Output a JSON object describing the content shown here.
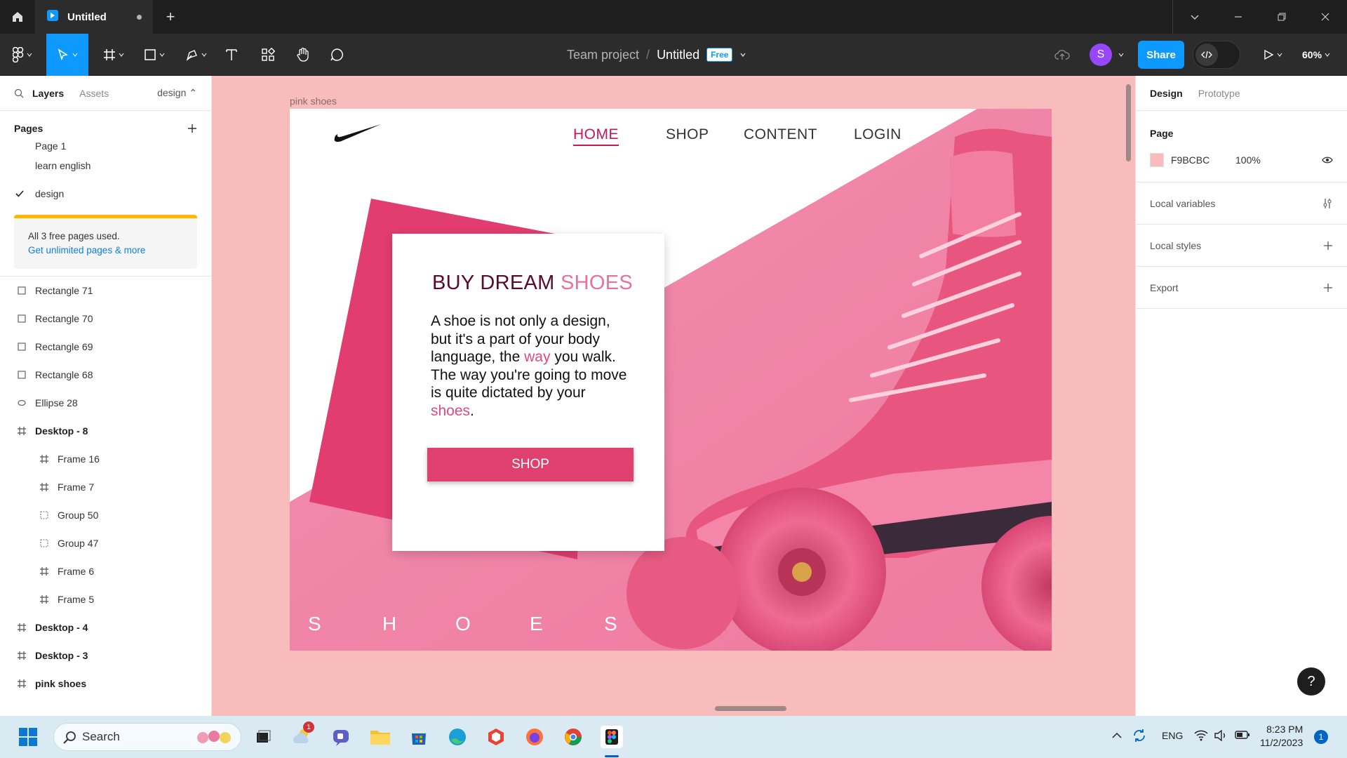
{
  "titlebar": {
    "tab_title": "Untitled",
    "new_tab": "+"
  },
  "toolbar": {
    "team": "Team project",
    "separator": "/",
    "file": "Untitled",
    "plan_badge": "Free",
    "avatar_initial": "S",
    "share_label": "Share",
    "zoom": "60%"
  },
  "left_panel": {
    "tabs": {
      "layers": "Layers",
      "assets": "Assets",
      "page_switch": "design"
    },
    "pages_title": "Pages",
    "pages": [
      {
        "label": "Page 1"
      },
      {
        "label": "learn english"
      },
      {
        "label": "design",
        "selected": true
      }
    ],
    "limit_notice": {
      "text": "All 3 free pages used.",
      "link": "Get unlimited pages & more"
    },
    "layers": [
      {
        "label": "Rectangle 71",
        "type": "rectangle",
        "indent": 0
      },
      {
        "label": "Rectangle 70",
        "type": "rectangle",
        "indent": 0
      },
      {
        "label": "Rectangle 69",
        "type": "rectangle",
        "indent": 0
      },
      {
        "label": "Rectangle 68",
        "type": "rectangle",
        "indent": 0
      },
      {
        "label": "Ellipse 28",
        "type": "ellipse",
        "indent": 0
      },
      {
        "label": "Desktop - 8",
        "type": "frame",
        "indent": 0,
        "bold": true
      },
      {
        "label": "Frame 16",
        "type": "frame",
        "indent": 1
      },
      {
        "label": "Frame 7",
        "type": "frame",
        "indent": 1
      },
      {
        "label": "Group 50",
        "type": "group",
        "indent": 1
      },
      {
        "label": "Group 47",
        "type": "group",
        "indent": 1
      },
      {
        "label": "Frame 6",
        "type": "frame",
        "indent": 1
      },
      {
        "label": "Frame 5",
        "type": "frame",
        "indent": 1
      },
      {
        "label": "Desktop - 4",
        "type": "frame",
        "indent": 0,
        "bold": true
      },
      {
        "label": "Desktop - 3",
        "type": "frame",
        "indent": 0,
        "bold": true
      },
      {
        "label": "pink shoes",
        "type": "frame",
        "indent": 0,
        "bold": true
      }
    ]
  },
  "canvas": {
    "frame_label": "pink shoes",
    "background": "#F9BCBC",
    "design": {
      "nav": [
        "HOME",
        "SHOP",
        "CONTENT",
        "LOGIN"
      ],
      "title_a": "BUY DREAM",
      "title_b": "SHOES",
      "body": [
        "A shoe is not only a design,",
        "but it's a part of your body",
        "language, the ",
        "way",
        " you walk.",
        "The way you're going to move",
        "is quite dictated by your",
        "shoes",
        "."
      ],
      "button": "SHOP",
      "letters": [
        "S",
        "H",
        "O",
        "E",
        "S"
      ]
    }
  },
  "right_panel": {
    "tabs": {
      "design": "Design",
      "prototype": "Prototype"
    },
    "page_section": "Page",
    "page_color": "F9BCBC",
    "page_opacity": "100%",
    "local_variables": "Local variables",
    "local_styles": "Local styles",
    "export": "Export",
    "help": "?"
  },
  "taskbar": {
    "search": "Search",
    "time": "8:23 PM",
    "date": "11/2/2023",
    "notification_count": "1",
    "weather_badge": "1",
    "lang": "ENG"
  },
  "colors": {
    "accent": "#0d99ff",
    "canvas": "#f9bcbc",
    "brand_pink": "#e0406e"
  }
}
